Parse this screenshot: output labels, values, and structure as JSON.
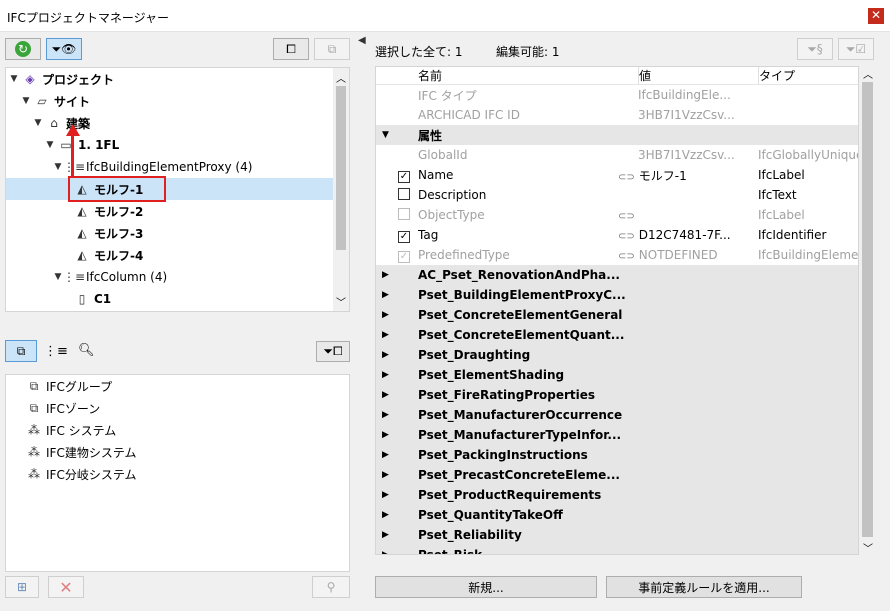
{
  "window": {
    "title": "IFCプロジェクトマネージャー",
    "close": "✕"
  },
  "tree": {
    "items": [
      {
        "label": "プロジェクト",
        "bold": true
      },
      {
        "label": "サイト",
        "bold": true
      },
      {
        "label": "建築",
        "bold": true
      },
      {
        "label": "1. 1FL",
        "bold": true
      },
      {
        "label": "IfcBuildingElementProxy (4)",
        "bold": false
      },
      {
        "label": "モルフ-1",
        "bold": true
      },
      {
        "label": "モルフ-2",
        "bold": true
      },
      {
        "label": "モルフ-3",
        "bold": true
      },
      {
        "label": "モルフ-4",
        "bold": true
      },
      {
        "label": "IfcColumn (4)",
        "bold": false
      },
      {
        "label": "C1",
        "bold": true
      }
    ]
  },
  "lower": {
    "items": [
      "IFCグループ",
      "IFCゾーン",
      "IFC システム",
      "IFC建物システム",
      "IFC分岐システム"
    ]
  },
  "right": {
    "selected_label": "選択した全て: 1",
    "editable_label": "編集可能: 1",
    "columns": [
      "名前",
      "値",
      "タイプ"
    ],
    "rows": [
      {
        "name": "IFC タイプ",
        "value": "IfcBuildingEle...",
        "type": ""
      },
      {
        "name": "ARCHICAD IFC ID",
        "value": "3HB7I1VzzCsv...",
        "type": ""
      }
    ],
    "attr_group": "属性",
    "attributes": [
      {
        "name": "GlobalId",
        "value": "3HB7I1VzzCsv...",
        "type": "IfcGloballyUnique"
      },
      {
        "name": "Name",
        "value": "モルフ-1",
        "type": "IfcLabel"
      },
      {
        "name": "Description",
        "value": "",
        "type": "IfcText"
      },
      {
        "name": "ObjectType",
        "value": "",
        "type": "IfcLabel"
      },
      {
        "name": "Tag",
        "value": "D12C7481-7F...",
        "type": "IfcIdentifier"
      },
      {
        "name": "PredefinedType",
        "value": "NOTDEFINED",
        "type": "IfcBuildingElemer"
      }
    ],
    "psets": [
      "AC_Pset_RenovationAndPha...",
      "Pset_BuildingElementProxyC...",
      "Pset_ConcreteElementGeneral",
      "Pset_ConcreteElementQuant...",
      "Pset_Draughting",
      "Pset_ElementShading",
      "Pset_FireRatingProperties",
      "Pset_ManufacturerOccurrence",
      "Pset_ManufacturerTypeInfor...",
      "Pset_PackingInstructions",
      "Pset_PrecastConcreteEleme...",
      "Pset_ProductRequirements",
      "Pset_QuantityTakeOff",
      "Pset_Reliability",
      "Pset_Risk"
    ],
    "new_button": "新規...",
    "apply_button": "事前定義ルールを適用..."
  }
}
